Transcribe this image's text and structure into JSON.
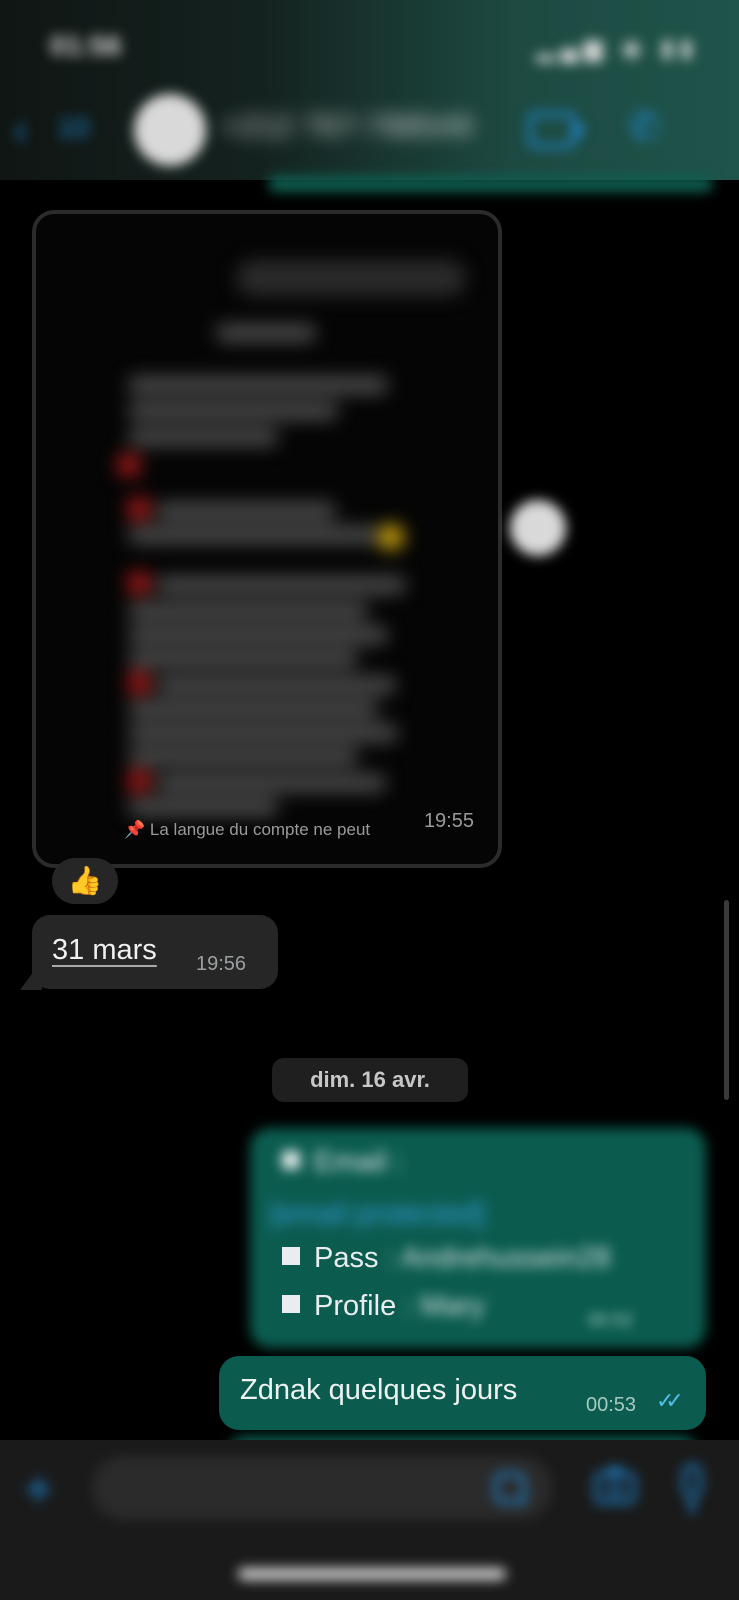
{
  "status": {
    "time": "01:56",
    "icons": "▂▄▆ ◉ ▮▮"
  },
  "header": {
    "back_count": "10",
    "contact_name": "+212 767-788549",
    "avatar_color": "#d9d9d9",
    "accent": "#1f8ad6"
  },
  "chat": {
    "image_message": {
      "visible_line": "La langue du compte ne peut",
      "time": "19:55"
    },
    "reaction": "👍",
    "received": {
      "text": "31 mars",
      "time": "19:56"
    },
    "date_separator": "dim. 16 avr.",
    "sent_credentials": {
      "email_label": "Email :",
      "email_value": "[email protected]",
      "pass_label": "Pass",
      "pass_value": ": Andrehussein28",
      "profile_label": "Profile",
      "profile_value": ": Mary",
      "time": "00:52"
    },
    "sent_plain": {
      "text": "Zdnak quelques jours",
      "time": "00:53",
      "ticks": "✓✓"
    }
  },
  "composer": {
    "placeholder": ""
  },
  "colors": {
    "sent_bubble": "#0b5c4f",
    "received_bubble": "#262626",
    "background": "#000000"
  }
}
